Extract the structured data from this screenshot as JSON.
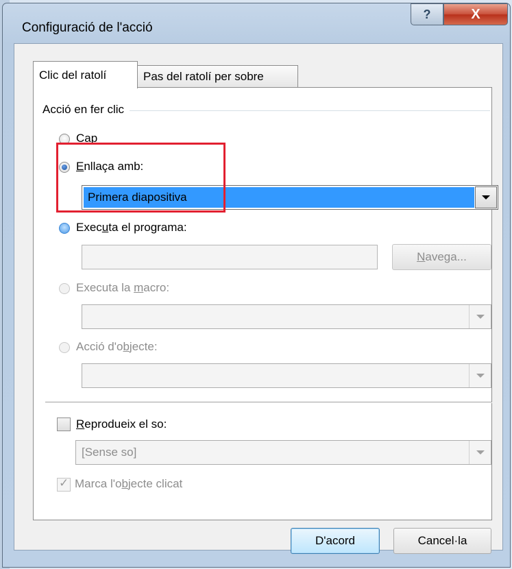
{
  "window": {
    "title": "Configuració de l'acció",
    "help_glyph": "?",
    "close_glyph": "X"
  },
  "tabs": [
    {
      "label": "Clic del ratolí",
      "active": true
    },
    {
      "label": "Pas del ratolí per sobre",
      "active": false
    }
  ],
  "group": {
    "label": "Acció en fer clic"
  },
  "options": {
    "none": {
      "label": "Cap"
    },
    "link": {
      "label_pre": "",
      "label_u": "E",
      "label_post": "nllaça amb:",
      "value": "Primera diapositiva"
    },
    "run_program": {
      "label_pre": "Exec",
      "label_u": "u",
      "label_post": "ta el programa:",
      "value": "",
      "browse_pre": "",
      "browse_u": "N",
      "browse_post": "avega..."
    },
    "run_macro": {
      "label_pre": "Executa la ",
      "label_u": "m",
      "label_post": "acro:",
      "value": ""
    },
    "object_action": {
      "label_pre": "Acció d'o",
      "label_u": "b",
      "label_post": "jecte:",
      "value": ""
    }
  },
  "sound": {
    "label_pre": "",
    "label_u": "R",
    "label_post": "eprodueix el so:",
    "value": "[Sense so]"
  },
  "highlight": {
    "label_pre": "Marca l'o",
    "label_u": "b",
    "label_post": "jecte clicat"
  },
  "buttons": {
    "ok": "D'acord",
    "cancel": "Cancel·la"
  },
  "colors": {
    "highlight_box": "#e22030",
    "selection": "#3399ff"
  }
}
